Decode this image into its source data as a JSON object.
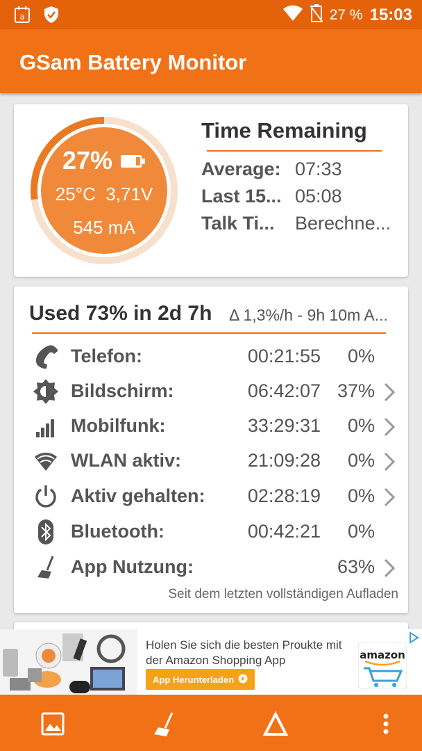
{
  "status_bar": {
    "battery_percent": "27 %",
    "clock": "15:03",
    "icons": [
      "amazon-notification-icon",
      "shield-check-icon",
      "wifi-icon",
      "battery-charging-off-icon"
    ]
  },
  "app_bar": {
    "title": "GSam Battery Monitor"
  },
  "gauge": {
    "percent": "27%",
    "percent_value": 27,
    "temperature": "25°C",
    "voltage": "3,71V",
    "current": "545 mA"
  },
  "time_remaining": {
    "title": "Time Remaining",
    "rows": [
      {
        "label": "Average:",
        "value": "07:33"
      },
      {
        "label": "Last 15...",
        "value": "05:08"
      },
      {
        "label": "Talk Ti...",
        "value": "Berechne..."
      }
    ]
  },
  "usage": {
    "title": "Used 73% in 2d 7h",
    "rate": "Δ 1,3%/h - 9h 10m A...",
    "rows": [
      {
        "icon": "phone-icon",
        "label": "Telefon:",
        "time": "00:21:55",
        "percent": "0%",
        "has_chevron": false
      },
      {
        "icon": "brightness-icon",
        "label": "Bildschirm:",
        "time": "06:42:07",
        "percent": "37%",
        "has_chevron": true
      },
      {
        "icon": "signal-bars-icon",
        "label": "Mobilfunk:",
        "time": "33:29:31",
        "percent": "0%",
        "has_chevron": true
      },
      {
        "icon": "wifi-icon",
        "label": "WLAN aktiv:",
        "time": "21:09:28",
        "percent": "0%",
        "has_chevron": true
      },
      {
        "icon": "power-icon",
        "label": "Aktiv gehalten:",
        "time": "02:28:19",
        "percent": "0%",
        "has_chevron": true
      },
      {
        "icon": "bluetooth-icon",
        "label": "Bluetooth:",
        "time": "00:42:21",
        "percent": "0%",
        "has_chevron": false
      },
      {
        "icon": "broom-icon",
        "label": "App Nutzung:",
        "time": "",
        "percent": "63%",
        "has_chevron": true
      }
    ],
    "footnote": "Seit dem letzten vollständigen Aufladen"
  },
  "ad": {
    "text": "Holen Sie sich die besten Proukte mit der Amazon Shopping App",
    "button": "App Herunterladen",
    "logo_text": "amazon"
  },
  "bottom_bar": {
    "buttons": [
      "image-icon",
      "broom-icon",
      "delta-icon",
      "more-vert-icon"
    ]
  },
  "colors": {
    "primary": "#f17117",
    "status_bar": "#e4620a",
    "gauge_fill": "#f08a3a",
    "accent_line": "#f17117"
  }
}
